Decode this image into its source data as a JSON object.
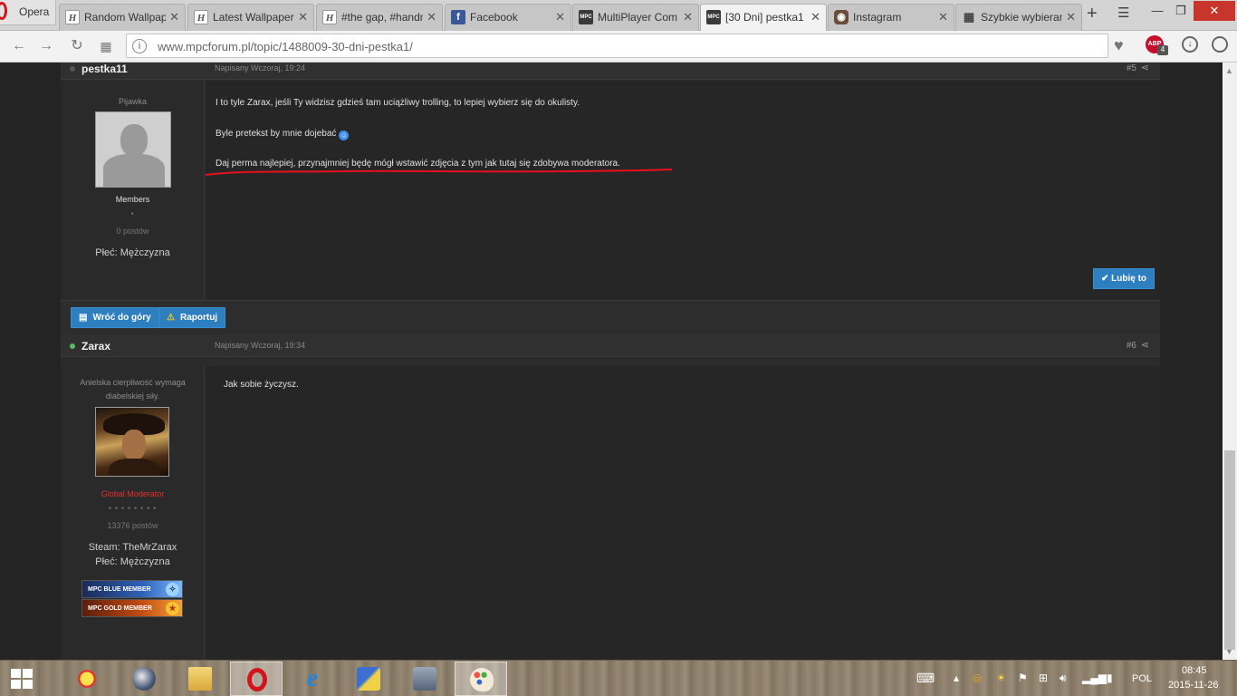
{
  "browser": {
    "menu_label": "Opera",
    "tabs": [
      {
        "title": "Random Wallpapers",
        "icon": "H"
      },
      {
        "title": "Latest Wallpapers",
        "icon": "H"
      },
      {
        "title": "#the gap, #handm",
        "icon": "H"
      },
      {
        "title": "Facebook",
        "icon": "f"
      },
      {
        "title": "MultiPlayer Com",
        "icon": "MPC"
      },
      {
        "title": "[30 Dni] pestka1",
        "icon": "MPC"
      },
      {
        "title": "Instagram",
        "icon": "ig"
      },
      {
        "title": "Szybkie wybieranie",
        "icon": "grid"
      }
    ],
    "url": "www.mpcforum.pl/topic/1488009-30-dni-pestka1/",
    "abp_label": "ABP",
    "abp_count": "4"
  },
  "posts": [
    {
      "author": "pestka11",
      "date": "Napisany Wczoraj, 19:24",
      "number": "#5",
      "user_title": "Pijawka",
      "group": "Members",
      "pips": "▪",
      "post_count": "0 postów",
      "fields": [
        "Płeć: Mężczyzna"
      ],
      "lines": [
        "I to tyle Zarax, jeśli Ty widzisz gdzieś tam uciążliwy trolling, to lepiej wybierz się do okulisty.",
        "Byle pretekst by mnie dojebać",
        "Daj perma najlepiej, przynajmniej będę mógł wstawić zdjęcia z tym jak tutaj się zdobywa moderatora."
      ],
      "like_label": "✔ Lubię to"
    },
    {
      "author": "Zarax",
      "date": "Napisany Wczoraj, 19:34",
      "number": "#6",
      "user_title_lines": [
        "Anielska cierpliwość wymaga",
        "diabelskiej siły."
      ],
      "group": "Global Moderator",
      "pips": "▪ ▪ ▪ ▪ ▪ ▪ ▪ ▪",
      "post_count": "13376 postów",
      "fields": [
        "Steam: TheMrZarax",
        "Płeć: Mężczyzna"
      ],
      "badges": [
        "MPC BLUE MEMBER",
        "MPC GOLD MEMBER"
      ],
      "lines": [
        "Jak sobie życzysz."
      ]
    }
  ],
  "actions": {
    "back_to_top": "Wróć do góry",
    "report": "Raportuj"
  },
  "taskbar": {
    "language": "POL",
    "time": "08:45",
    "date": "2015-11-26"
  },
  "colors": {
    "accent_blue": "#2e7fc0",
    "moderator_red": "#e0312a",
    "online_green": "#5cb85c",
    "underline_red": "#e8101b"
  }
}
